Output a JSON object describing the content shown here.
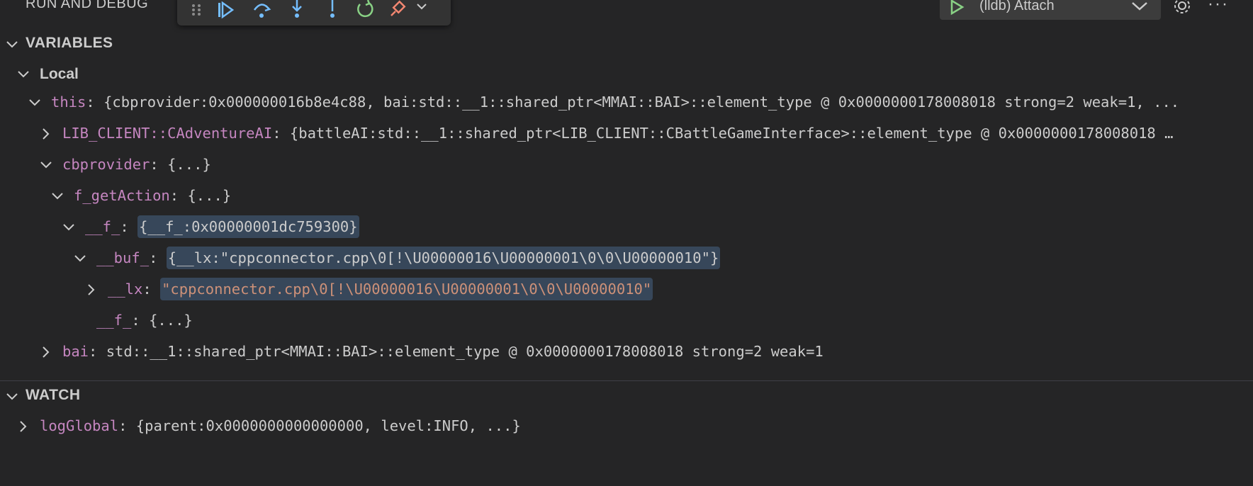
{
  "header": {
    "title": "RUN AND DEBUG",
    "launch_config": "(lldb) Attach",
    "more_label": "···"
  },
  "toolbar": {
    "icons": [
      "drag-handle-icon",
      "continue-icon",
      "step-over-icon",
      "step-into-icon",
      "step-out-icon",
      "restart-icon",
      "disconnect-icon",
      "chevron-down-icon"
    ]
  },
  "colors": {
    "background": "#252526",
    "variable_name": "#c586c0",
    "string_value": "#ce9178",
    "highlight": "#37475a",
    "run_green": "#89d185"
  },
  "variables": {
    "title": "VARIABLES",
    "scope": "Local",
    "rows": [
      {
        "name": "this",
        "value": "{cbprovider:0x000000016b8e4c88, bai:std::__1::shared_ptr<MMAI::BAI>::element_type @ 0x0000000178008018 strong=2 weak=1, ..."
      },
      {
        "name": "LIB_CLIENT::CAdventureAI",
        "value": "{battleAI:std::__1::shared_ptr<LIB_CLIENT::CBattleGameInterface>::element_type @ 0x0000000178008018 …"
      },
      {
        "name": "cbprovider",
        "value": "{...}"
      },
      {
        "name": "f_getAction",
        "value": "{...}"
      },
      {
        "name": "__f_",
        "value": "{__f_:0x00000001dc759300}"
      },
      {
        "name": "__buf_",
        "value": "{__lx:\"cppconnector.cpp\\0[!\\U00000016\\U00000001\\0\\0\\U00000010\"}"
      },
      {
        "name": "__lx",
        "value": "\"cppconnector.cpp\\0[!\\U00000016\\U00000001\\0\\0\\U00000010\""
      },
      {
        "name": "__f_",
        "value": "{...}"
      },
      {
        "name": "bai",
        "value": "std::__1::shared_ptr<MMAI::BAI>::element_type @ 0x0000000178008018 strong=2 weak=1"
      }
    ]
  },
  "watch": {
    "title": "WATCH",
    "rows": [
      {
        "name": "logGlobal",
        "value": "{parent:0x0000000000000000, level:INFO, ...}"
      }
    ]
  }
}
